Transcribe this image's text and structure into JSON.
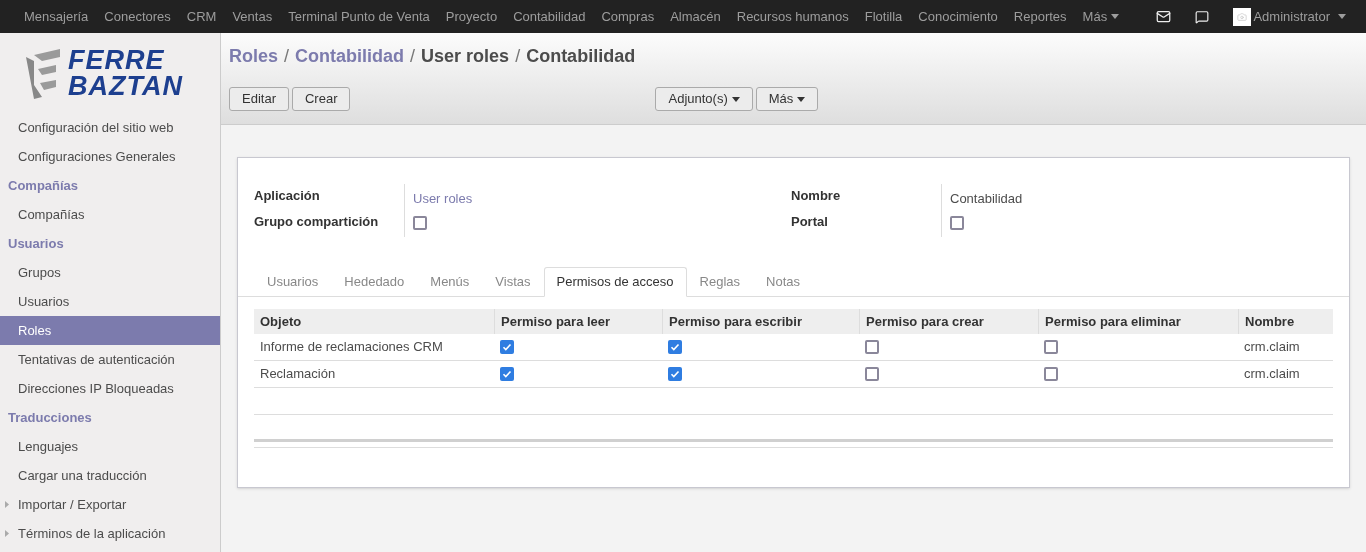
{
  "top_menu": {
    "items": [
      "Mensajería",
      "Conectores",
      "CRM",
      "Ventas",
      "Terminal Punto de Venta",
      "Proyecto",
      "Contabilidad",
      "Compras",
      "Almacén",
      "Recursos humanos",
      "Flotilla",
      "Conocimiento",
      "Reportes"
    ],
    "more": "Más",
    "user": "Administrator"
  },
  "logo": {
    "line_1": "FERRE",
    "line_2": "BAZTAN"
  },
  "sidebar": {
    "items": [
      {
        "kind": "item",
        "label": "Configuración del sitio web",
        "selected": false
      },
      {
        "kind": "item",
        "label": "Configuraciones Generales",
        "selected": false
      },
      {
        "kind": "header",
        "label": "Compañías"
      },
      {
        "kind": "item",
        "label": "Compañías",
        "selected": false
      },
      {
        "kind": "header",
        "label": "Usuarios"
      },
      {
        "kind": "item",
        "label": "Grupos",
        "selected": false
      },
      {
        "kind": "item",
        "label": "Usuarios",
        "selected": false
      },
      {
        "kind": "item",
        "label": "Roles",
        "selected": true
      },
      {
        "kind": "item",
        "label": "Tentativas de autenticación",
        "selected": false
      },
      {
        "kind": "item",
        "label": "Direcciones IP Bloqueadas",
        "selected": false
      },
      {
        "kind": "header",
        "label": "Traducciones"
      },
      {
        "kind": "item",
        "label": "Lenguajes",
        "selected": false
      },
      {
        "kind": "item",
        "label": "Cargar una traducción",
        "selected": false
      },
      {
        "kind": "folder",
        "label": "Importar / Exportar",
        "selected": false
      },
      {
        "kind": "folder",
        "label": "Términos de la aplicación",
        "selected": false
      }
    ]
  },
  "breadcrumb": {
    "separator": "/",
    "items": [
      {
        "label": "Roles",
        "link": true
      },
      {
        "label": "Contabilidad",
        "link": true
      },
      {
        "label": "User roles",
        "link": false
      },
      {
        "label": "Contabilidad",
        "link": false
      }
    ]
  },
  "buttons": {
    "left": [
      "Editar",
      "Crear"
    ],
    "dropdowns": [
      "Adjunto(s)",
      "Más"
    ]
  },
  "form": {
    "fields_left": [
      {
        "label": "Aplicación",
        "kind": "link",
        "value": "User roles"
      },
      {
        "label": "Grupo compartición",
        "kind": "checkbox",
        "checked": false
      }
    ],
    "fields_right": [
      {
        "label": "Nombre",
        "kind": "text",
        "value": "Contabilidad"
      },
      {
        "label": "Portal",
        "kind": "checkbox",
        "checked": false
      }
    ]
  },
  "tabs": [
    {
      "label": "Usuarios",
      "selected": false
    },
    {
      "label": "Hededado",
      "selected": false
    },
    {
      "label": "Menús",
      "selected": false
    },
    {
      "label": "Vistas",
      "selected": false
    },
    {
      "label": "Permisos de acceso",
      "selected": true
    },
    {
      "label": "Reglas",
      "selected": false
    },
    {
      "label": "Notas",
      "selected": false
    }
  ],
  "table": {
    "columns": [
      "Objeto",
      "Permiso para leer",
      "Permiso para escribir",
      "Permiso para crear",
      "Permiso para eliminar",
      "Nombre"
    ],
    "rows": [
      {
        "object": "Informe de reclamaciones CRM",
        "read": true,
        "write": true,
        "create": false,
        "delete": false,
        "name": "crm.claim"
      },
      {
        "object": "Reclamación",
        "read": true,
        "write": true,
        "create": false,
        "delete": false,
        "name": "crm.claim"
      }
    ]
  }
}
